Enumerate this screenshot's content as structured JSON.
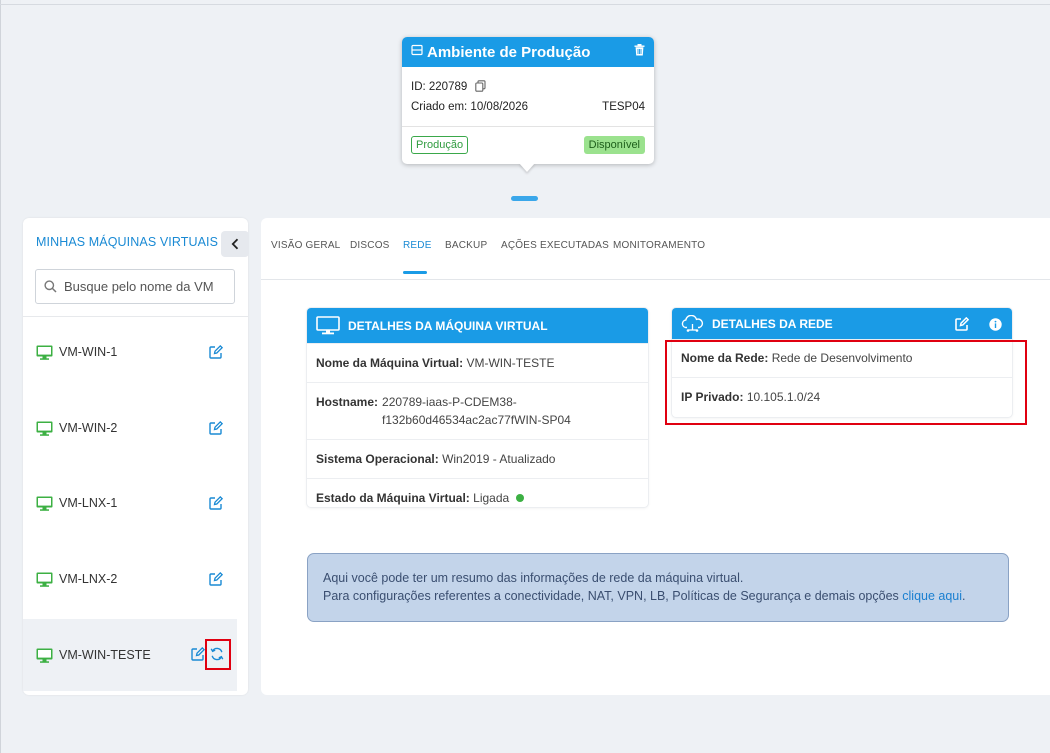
{
  "environment": {
    "title": "Ambiente de Produção",
    "id_label": "ID: 220789",
    "created_label": "Criado em: 10/08/2026",
    "code": "TESP04",
    "tag_environment": "Produção",
    "tag_status": "Disponível"
  },
  "sidebar": {
    "title": "MINHAS MÁQUINAS VIRTUAIS",
    "search_placeholder": "Busque pelo nome da VM",
    "vms": [
      {
        "name": "VM-WIN-1"
      },
      {
        "name": "VM-WIN-2"
      },
      {
        "name": "VM-LNX-1"
      },
      {
        "name": "VM-LNX-2"
      },
      {
        "name": "VM-WIN-TESTE"
      }
    ]
  },
  "tabs": [
    "VISÃO GERAL",
    "DISCOS",
    "REDE",
    "BACKUP",
    "AÇÕES EXECUTADAS",
    "MONITORAMENTO"
  ],
  "active_tab": "REDE",
  "vm_details": {
    "title": "DETALHES DA MÁQUINA VIRTUAL",
    "name_label": "Nome da Máquina Virtual:",
    "name_value": "VM-WIN-TESTE",
    "hostname_label": "Hostname:",
    "hostname_line1": "220789-iaas-P-CDEM38-",
    "hostname_line2": "f132b60d46534ac2ac77fWIN-SP04",
    "os_label": "Sistema Operacional:",
    "os_value": "Win2019 - Atualizado",
    "state_label": "Estado da Máquina Virtual:",
    "state_value": "Ligada"
  },
  "network_details": {
    "title": "DETALHES DA REDE",
    "network_label": "Nome da Rede:",
    "network_value": "Rede de Desenvolvimento",
    "ip_label": "IP Privado:",
    "ip_value": "10.105.1.0/24"
  },
  "info": {
    "line1": "Aqui você pode ter um resumo das informações de rede da máquina virtual.",
    "line2": "Para configurações referentes a conectividade, NAT, VPN, LB, Políticas de Segurança e demais opções",
    "link": "clique aqui",
    "period": "."
  },
  "colors": {
    "primary": "#1a9be6",
    "vm_icon": "#3cb043",
    "highlight": "#e00010",
    "info_bg": "#c3d4ea"
  }
}
